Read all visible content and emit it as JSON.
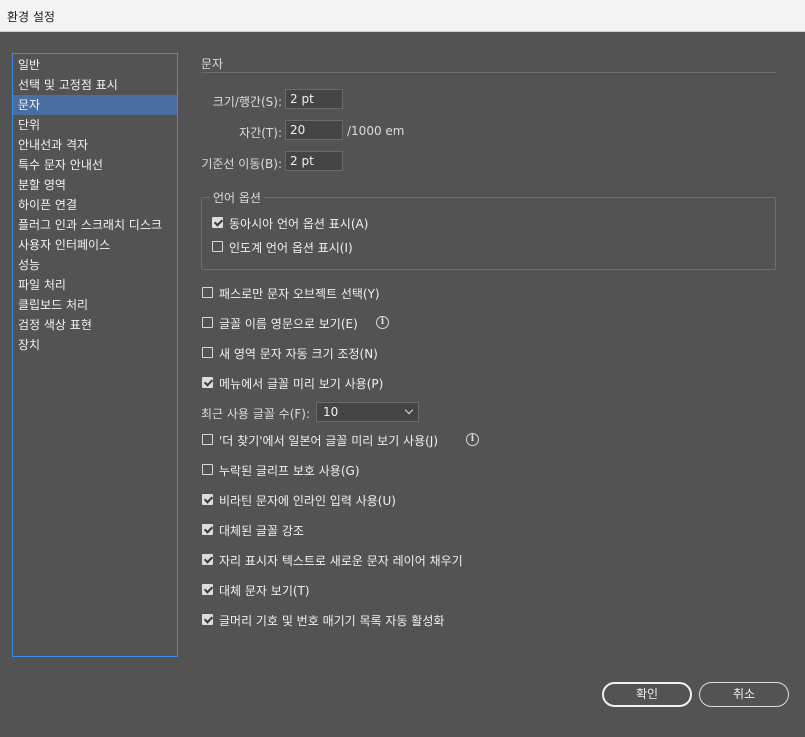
{
  "window": {
    "title": "환경 설정"
  },
  "sidebar": {
    "items": [
      {
        "label": "일반",
        "selected": false
      },
      {
        "label": "선택 및 고정점 표시",
        "selected": false
      },
      {
        "label": "문자",
        "selected": true
      },
      {
        "label": "단위",
        "selected": false
      },
      {
        "label": "안내선과 격자",
        "selected": false
      },
      {
        "label": "특수 문자 안내선",
        "selected": false
      },
      {
        "label": "분할 영역",
        "selected": false
      },
      {
        "label": "하이픈 연결",
        "selected": false
      },
      {
        "label": "플러그 인과 스크래치 디스크",
        "selected": false
      },
      {
        "label": "사용자 인터페이스",
        "selected": false
      },
      {
        "label": "성능",
        "selected": false
      },
      {
        "label": "파일 처리",
        "selected": false
      },
      {
        "label": "클립보드 처리",
        "selected": false
      },
      {
        "label": "검정 색상 표현",
        "selected": false
      },
      {
        "label": "장치",
        "selected": false
      }
    ]
  },
  "panel": {
    "title": "문자",
    "size_leading": {
      "label": "크기/행간(S):",
      "value": "2 pt"
    },
    "tracking": {
      "label": "자간(T):",
      "value": "20",
      "unit": "/1000 em"
    },
    "baseline_shift": {
      "label": "기준선 이동(B):",
      "value": "2 pt"
    },
    "language_options": {
      "title": "언어 옵션",
      "items": [
        {
          "label": "동아시아 언어 옵션 표시(A)",
          "checked": true
        },
        {
          "label": "인도계 언어 옵션 표시(I)",
          "checked": false
        }
      ]
    },
    "options": [
      {
        "label": "패스로만 문자 오브젝트 선택(Y)",
        "checked": false
      },
      {
        "label": "글꼴 이름 영문으로 보기(E)",
        "checked": false,
        "info": true
      },
      {
        "label": "새 영역 문자 자동 크기 조정(N)",
        "checked": false
      },
      {
        "label": "메뉴에서 글꼴 미리 보기 사용(P)",
        "checked": true
      }
    ],
    "recent_fonts": {
      "label": "최근 사용 글꼴 수(F):",
      "value": "10"
    },
    "options2": [
      {
        "label": "'더 찾기'에서 일본어 글꼴 미리 보기 사용(J)",
        "checked": false,
        "info": true
      },
      {
        "label": "누락된 글리프 보호 사용(G)",
        "checked": false
      },
      {
        "label": "비라틴 문자에 인라인 입력 사용(U)",
        "checked": true
      },
      {
        "label": "대체된 글꼴 강조",
        "checked": true
      },
      {
        "label": "자리 표시자 텍스트로 새로운 문자 레이어 채우기",
        "checked": true
      },
      {
        "label": "대체 문자 보기(T)",
        "checked": true
      },
      {
        "label": "글머리 기호 및 번호 매기기 목록 자동 활성화",
        "checked": true
      }
    ],
    "info_glyph": "i"
  },
  "buttons": {
    "ok": "확인",
    "cancel": "취소"
  }
}
